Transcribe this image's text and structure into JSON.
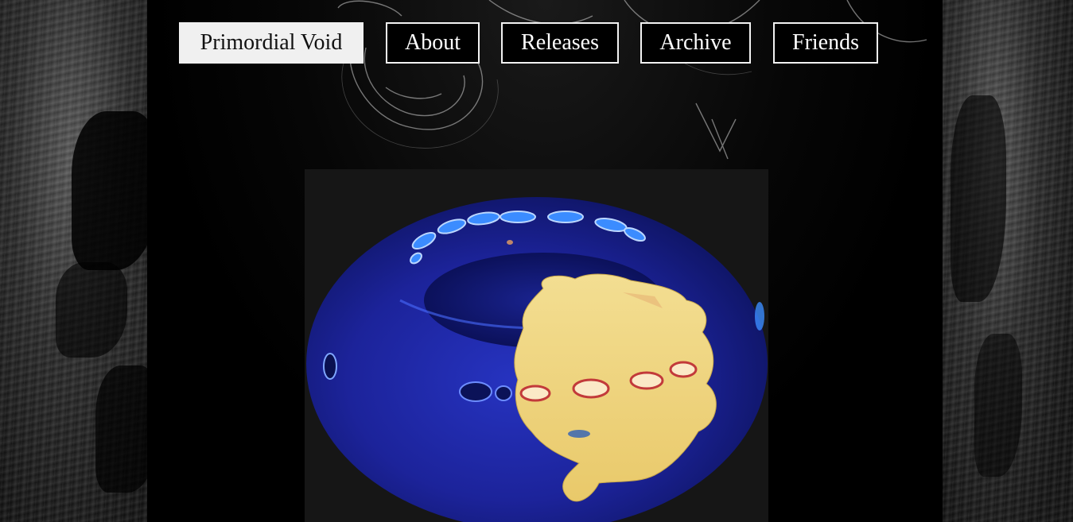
{
  "nav": {
    "home_label": "Primordial Void",
    "about_label": "About",
    "releases_label": "Releases",
    "archive_label": "Archive",
    "friends_label": "Friends"
  },
  "colors": {
    "background": "#000000",
    "nav_border": "#f2f2f2",
    "nav_home_bg": "#f0f0f0",
    "torus_blue": "#1f2aa8",
    "blob_yellow": "#f0d27a",
    "glow_blue": "#3b8cff"
  }
}
